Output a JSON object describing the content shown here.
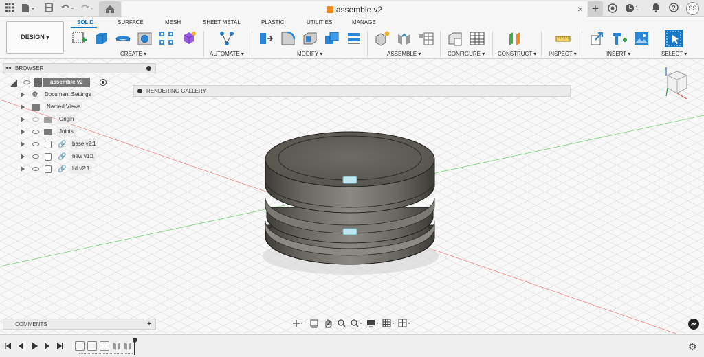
{
  "titlebar": {
    "document_title": "assemble v2",
    "close_glyph": "×",
    "plus_glyph": "+",
    "jobs_count": "1",
    "user_initials": "SS"
  },
  "ribbon": {
    "workspace": "DESIGN ▾",
    "tabs": [
      "SOLID",
      "SURFACE",
      "MESH",
      "SHEET METAL",
      "PLASTIC",
      "UTILITIES",
      "MANAGE"
    ],
    "active_tab": "SOLID",
    "groups": [
      "CREATE ▾",
      "AUTOMATE ▾",
      "MODIFY ▾",
      "ASSEMBLE ▾",
      "CONFIGURE ▾",
      "CONSTRUCT ▾",
      "INSPECT ▾",
      "INSERT ▾",
      "SELECT ▾"
    ]
  },
  "browser": {
    "title": "BROWSER",
    "root": "assemble v2",
    "items": [
      {
        "label": "Document Settings",
        "icon": "gear-icon",
        "visible": true
      },
      {
        "label": "Named Views",
        "icon": "folder-icon",
        "visible": true
      },
      {
        "label": "Origin",
        "icon": "folder-icon",
        "visible": false
      },
      {
        "label": "Joints",
        "icon": "folder-icon",
        "visible": true
      },
      {
        "label": "base v2:1",
        "icon": "component-icon",
        "visible": true
      },
      {
        "label": "new v1:1",
        "icon": "component-icon",
        "visible": true
      },
      {
        "label": "lid v2:1",
        "icon": "component-icon",
        "visible": true
      }
    ]
  },
  "rendering_gallery": {
    "label": "RENDERING GALLERY"
  },
  "comments": {
    "label": "COMMENTS",
    "add_glyph": "+"
  },
  "colors": {
    "accent": "#1677c5",
    "model_body": "#5c5953",
    "axis_red": "#e05656",
    "axis_green": "#4fc24f",
    "doc_icon": "#f28a1e"
  }
}
